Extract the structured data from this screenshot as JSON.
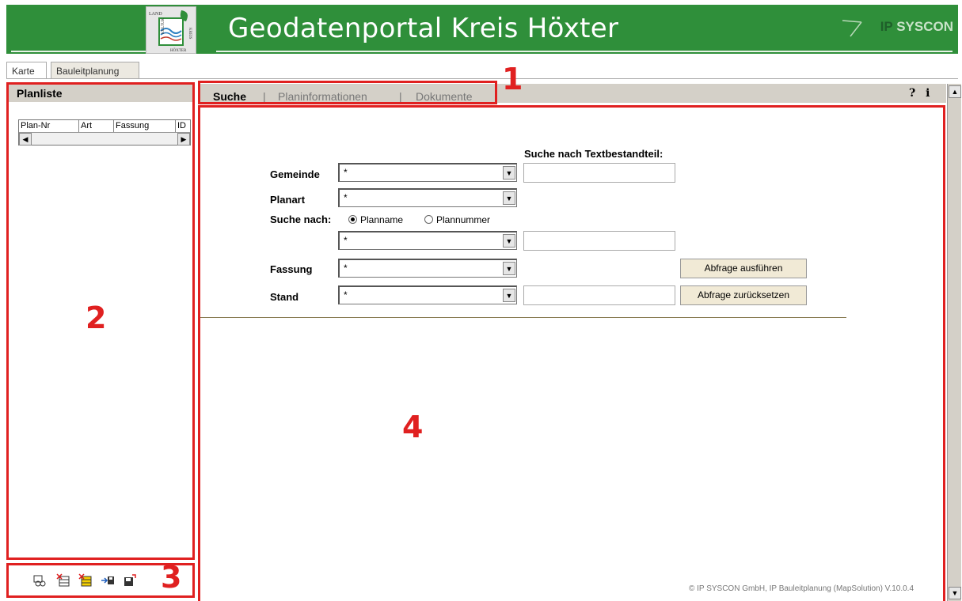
{
  "header": {
    "title": "Geodatenportal Kreis Höxter",
    "brand_ip": "IP",
    "brand_name": "SYSCON",
    "logo_texts": [
      "LAND",
      "KULTUR",
      "KREIS",
      "HÖXTER"
    ]
  },
  "main_tabs": [
    {
      "label": "Karte"
    },
    {
      "label": "Bauleitplanung"
    }
  ],
  "left_panel": {
    "title": "Planliste",
    "columns": [
      "Plan-Nr",
      "Art",
      "Fassung",
      "ID"
    ]
  },
  "subtabs": [
    {
      "label": "Suche",
      "active": true
    },
    {
      "label": "Planinformationen",
      "active": false
    },
    {
      "label": "Dokumente",
      "active": false
    }
  ],
  "subtab_separator": "|",
  "help_icons": {
    "help": "?",
    "info": "i"
  },
  "annotations": [
    "1",
    "2",
    "3",
    "4"
  ],
  "form": {
    "text_search_heading": "Suche nach Textbestandteil:",
    "gemeinde": {
      "label": "Gemeinde",
      "value": "*"
    },
    "planart": {
      "label": "Planart",
      "value": "*"
    },
    "suche_nach": {
      "label": "Suche nach:",
      "options": [
        "Planname",
        "Plannummer"
      ],
      "selected": "Planname"
    },
    "name_select": {
      "value": "*"
    },
    "fassung": {
      "label": "Fassung",
      "value": "*"
    },
    "stand": {
      "label": "Stand",
      "value": "*"
    },
    "execute_button": "Abfrage ausführen",
    "reset_button": "Abfrage zurücksetzen"
  },
  "footer": "© IP SYSCON GmbH, IP Bauleitplanung (MapSolution) V.10.0.4",
  "tools": [
    "glasses-icon",
    "remove-from-list-icon",
    "clear-list-icon",
    "import-icon",
    "save-icon"
  ]
}
